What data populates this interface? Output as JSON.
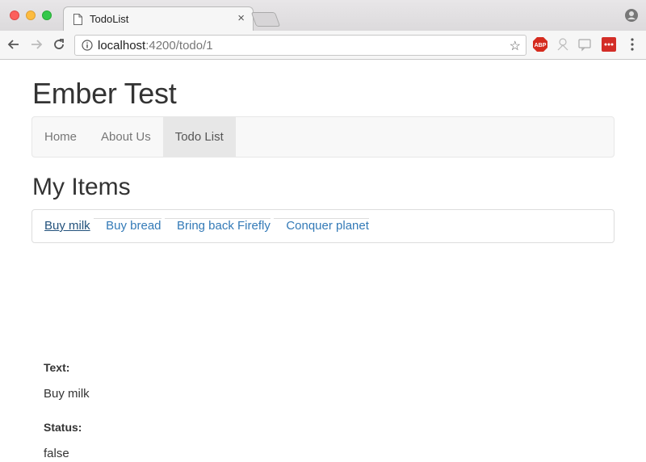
{
  "browser": {
    "tab_title": "TodoList",
    "tab_close": "×",
    "url_host": "localhost",
    "url_rest": ":4200/todo/1",
    "star": "☆"
  },
  "site": {
    "title": "Ember Test"
  },
  "nav": {
    "items": [
      {
        "label": "Home"
      },
      {
        "label": "About Us"
      },
      {
        "label": "Todo List"
      }
    ]
  },
  "items_section": {
    "title": "My Items",
    "items": [
      {
        "label": "Buy milk"
      },
      {
        "label": "Buy bread"
      },
      {
        "label": "Bring back Firefly"
      },
      {
        "label": "Conquer planet"
      }
    ]
  },
  "detail": {
    "text_label": "Text:",
    "text_value": "Buy milk",
    "status_label": "Status:",
    "status_value": "false"
  },
  "colors": {
    "link": "#337ab7",
    "link_active": "#23527c",
    "nav_active_bg": "#e7e7e7"
  }
}
